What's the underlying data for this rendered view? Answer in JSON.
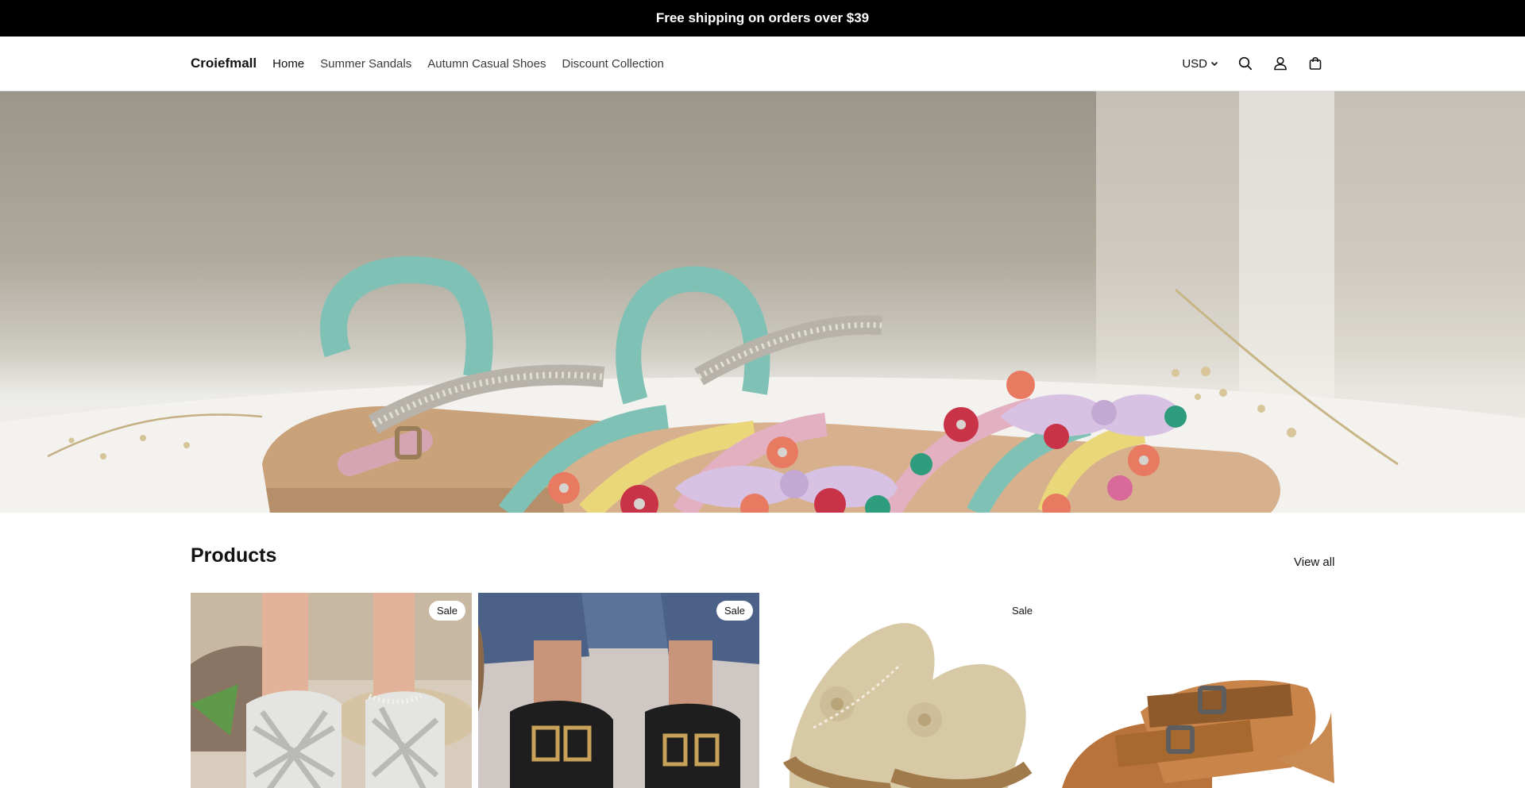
{
  "announcement": {
    "text": "Free shipping on orders over $39"
  },
  "header": {
    "logo": "Croiefmall",
    "nav": [
      {
        "label": "Home"
      },
      {
        "label": "Summer Sandals"
      },
      {
        "label": "Autumn Casual Shoes"
      },
      {
        "label": "Discount Collection"
      }
    ],
    "currency": "USD",
    "icons": [
      "chevron-down-icon",
      "search-icon",
      "account-icon",
      "cart-icon"
    ]
  },
  "products_section": {
    "title": "Products",
    "view_all": "View all",
    "cards": [
      {
        "badge": "Sale"
      },
      {
        "badge": "Sale"
      },
      {
        "badge": "Sale"
      },
      {
        "badge": ""
      }
    ]
  },
  "colors": {
    "announcement_bg": "#000000",
    "text": "#121212",
    "border": "#e6e6e6"
  }
}
